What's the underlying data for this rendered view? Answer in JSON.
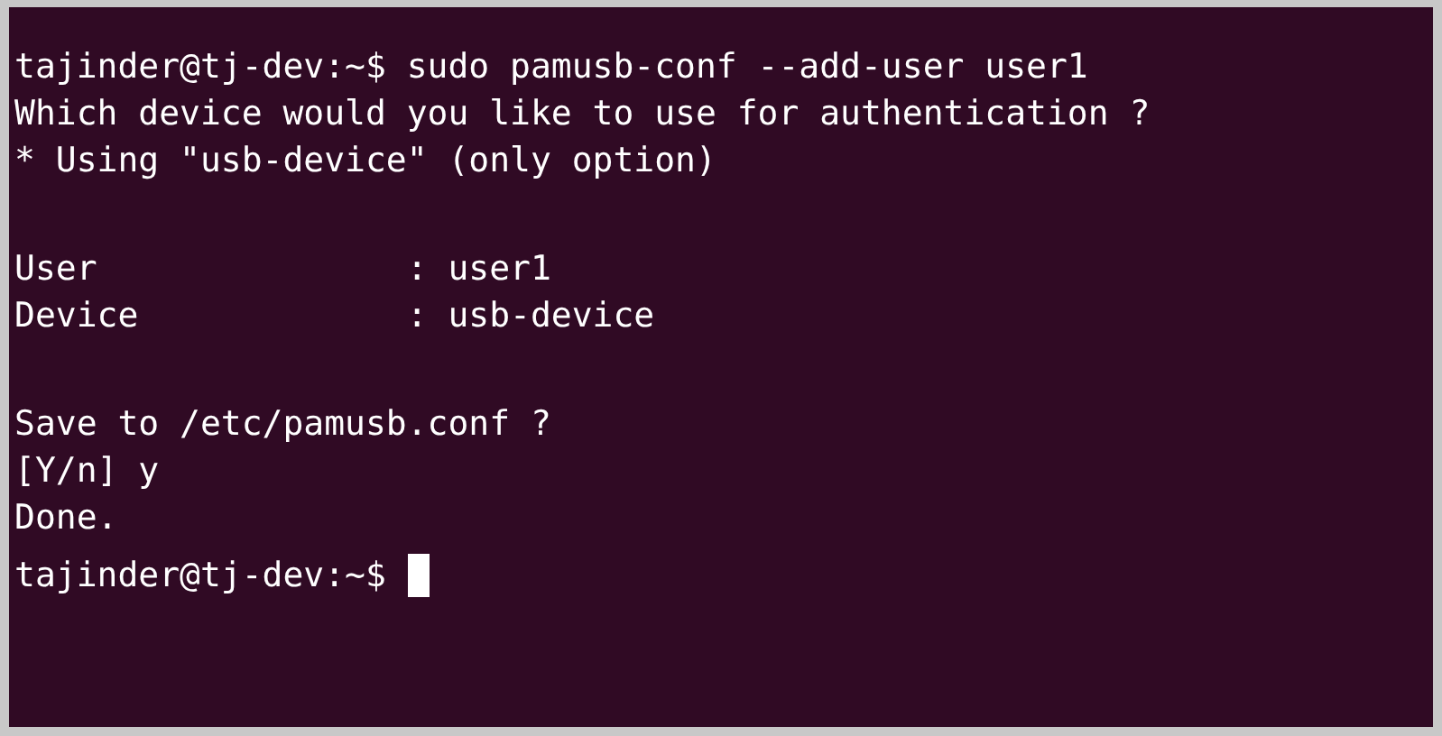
{
  "terminal": {
    "lines": [
      {
        "kind": "text",
        "text": "tajinder@tj-dev:~$ sudo pamusb-conf --add-user user1"
      },
      {
        "kind": "text",
        "text": "Which device would you like to use for authentication ?"
      },
      {
        "kind": "text",
        "text": "* Using \"usb-device\" (only option)"
      },
      {
        "kind": "blank"
      },
      {
        "kind": "text",
        "text": "User               : user1"
      },
      {
        "kind": "text",
        "text": "Device             : usb-device"
      },
      {
        "kind": "blank"
      },
      {
        "kind": "text",
        "text": "Save to /etc/pamusb.conf ?"
      },
      {
        "kind": "text",
        "text": "[Y/n] y"
      },
      {
        "kind": "text",
        "text": "Done."
      },
      {
        "kind": "text",
        "text": "tajinder@tj-dev:~$",
        "cursor": true
      }
    ]
  }
}
